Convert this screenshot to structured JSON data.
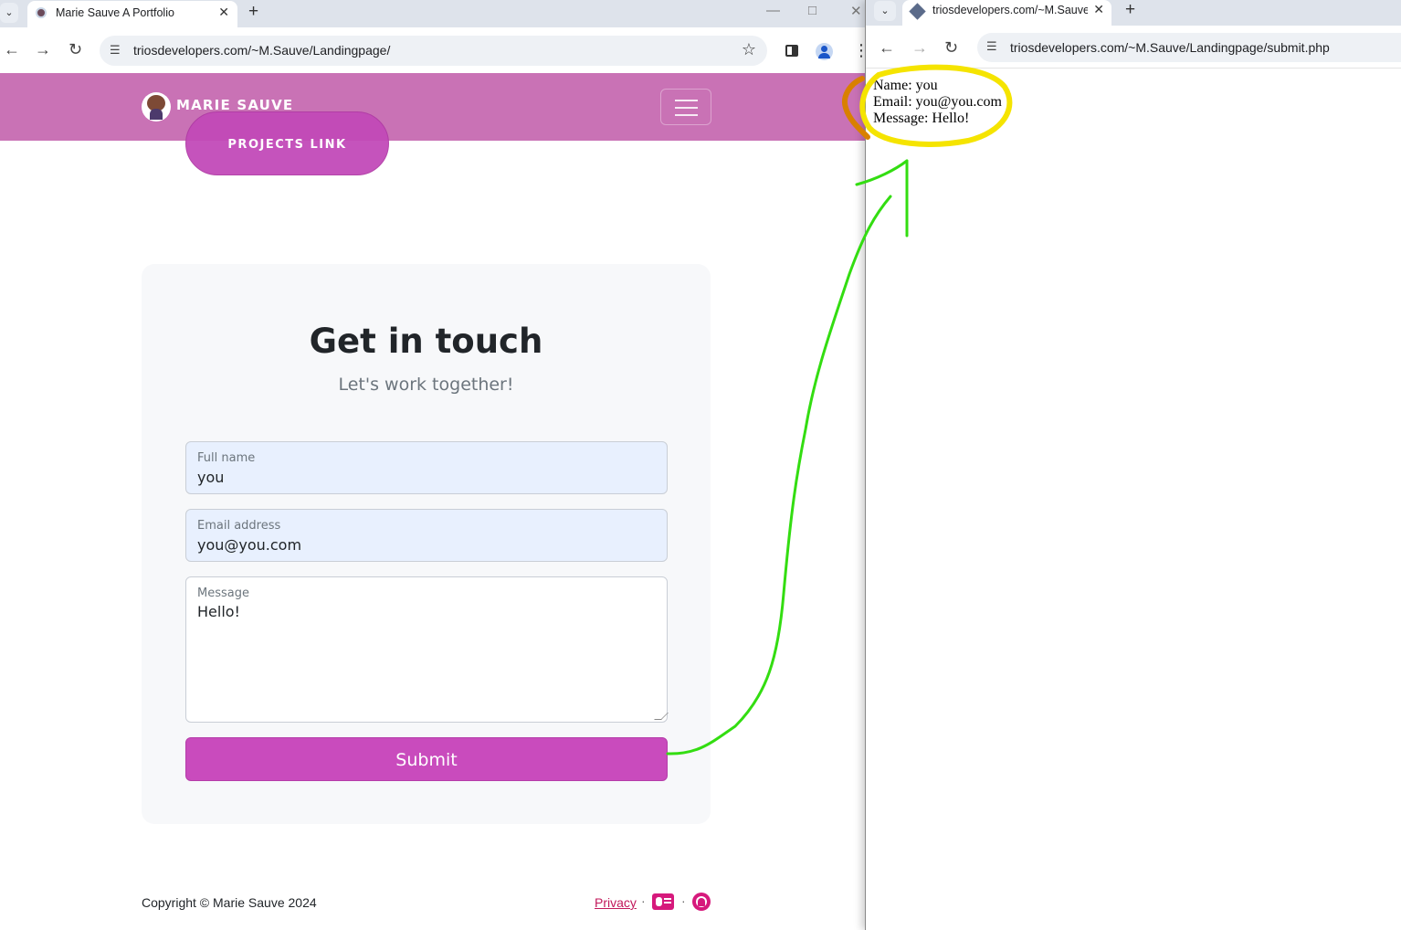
{
  "left_browser": {
    "tab_title": "Marie Sauve A Portfolio",
    "url": "triosdevelopers.com/~M.Sauve/Landingpage/"
  },
  "site": {
    "brand": "MARIE SAUVE",
    "projects_button": "PROJECTS LINK"
  },
  "contact": {
    "title": "Get in touch",
    "subtitle": "Let's work together!",
    "name_label": "Full name",
    "name_value": "you",
    "email_label": "Email address",
    "email_value": "you@you.com",
    "message_label": "Message",
    "message_value": "Hello!",
    "submit_label": "Submit"
  },
  "footer": {
    "copyright": "Copyright © Marie Sauve 2024",
    "privacy": "Privacy",
    "separator": "·"
  },
  "right_browser": {
    "tab_title": "triosdevelopers.com/~M.Sauve",
    "url": "triosdevelopers.com/~M.Sauve/Landingpage/submit.php"
  },
  "submission_output": {
    "name_line": "Name: you",
    "email_line": "Email: you@you.com",
    "message_line": "Message: Hello!"
  },
  "colors": {
    "nav_bg": "#c972b5",
    "accent_button": "#c94bbd",
    "link_pink": "#d6197c",
    "annotation_green": "#33dd11",
    "annotation_yellow": "#f5e400",
    "annotation_orange": "#d98000"
  }
}
